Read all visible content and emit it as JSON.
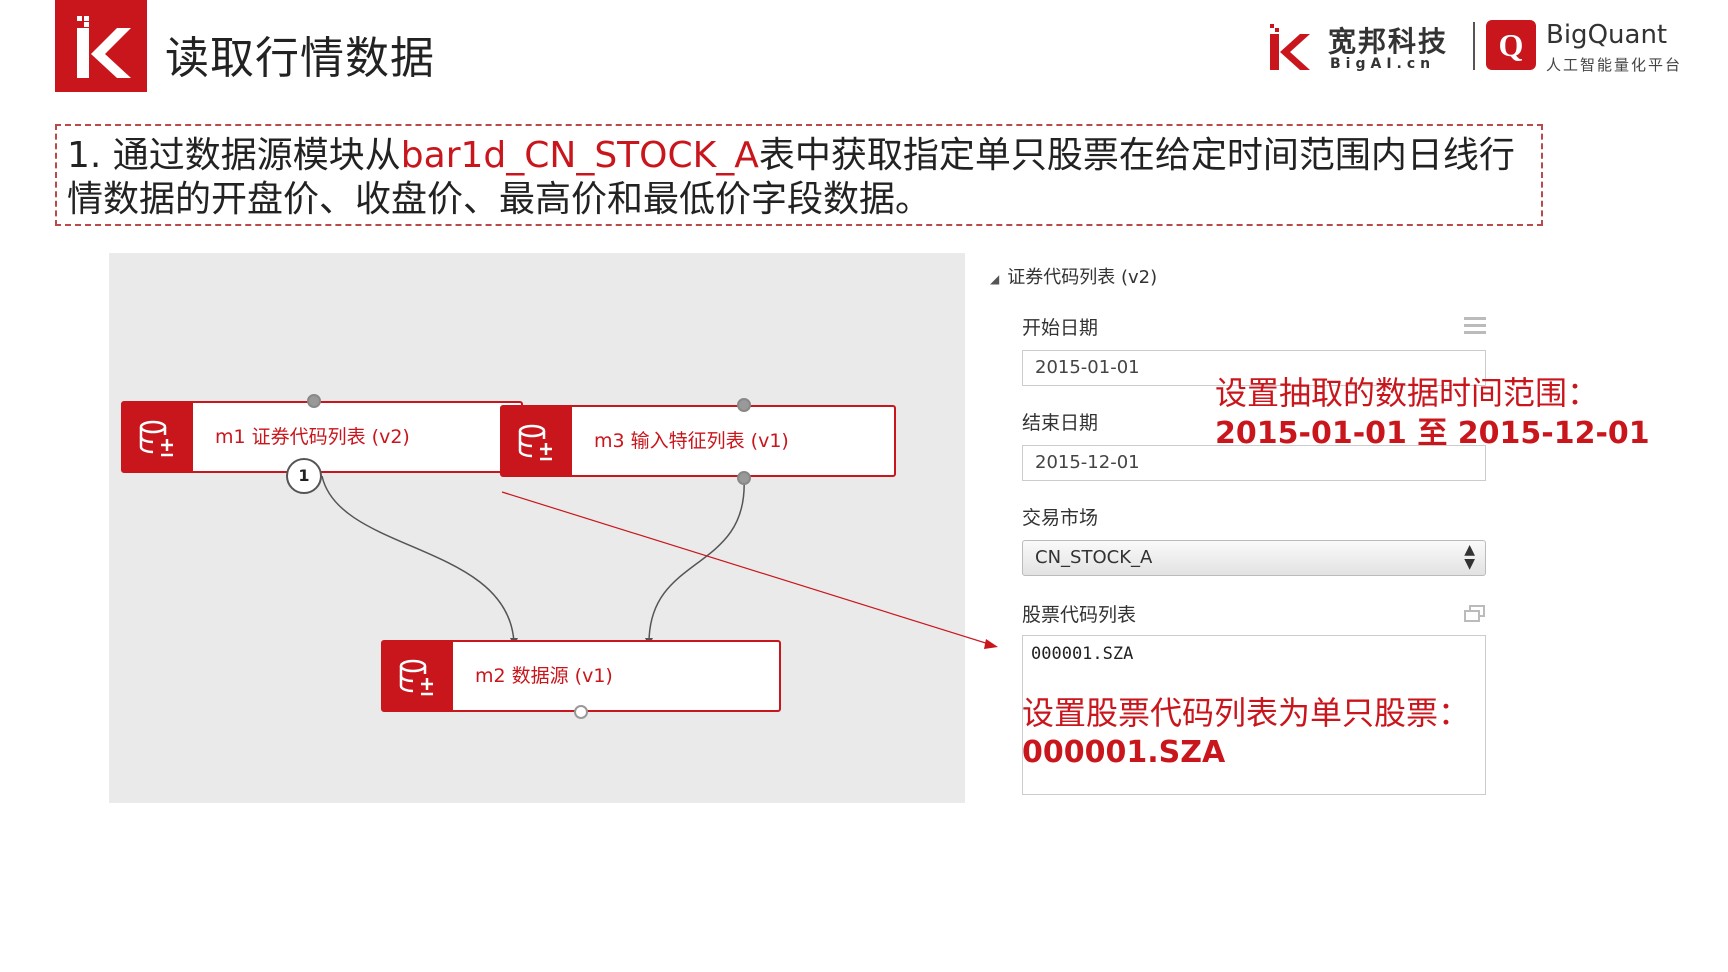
{
  "header": {
    "title": "读取行情数据",
    "brand": {
      "name": "宽邦科技",
      "sub": "BigAI.cn",
      "product": "BigQuant",
      "product_sub": "人工智能量化平台",
      "product_logo": "Q"
    }
  },
  "instruction": {
    "prefix": "1. 通过数据源模块从",
    "table": "bar1d_CN_STOCK_A",
    "suffix": "表中获取指定单只股票在给定时间范围内日线行情数据的开盘价、收盘价、最高价和最低价字段数据。"
  },
  "canvas": {
    "nodes": [
      {
        "id": "m1",
        "label": "m1 证券代码列表 (v2)",
        "icon": "database-add-icon"
      },
      {
        "id": "m3",
        "label": "m3 输入特征列表 (v1)",
        "icon": "database-add-icon"
      },
      {
        "id": "m2",
        "label": "m2 数据源 (v1)",
        "icon": "database-add-icon"
      }
    ],
    "port_badge": "1"
  },
  "panel": {
    "title": "证券代码列表 (v2)",
    "start_date": {
      "label": "开始日期",
      "value": "2015-01-01"
    },
    "end_date": {
      "label": "结束日期",
      "value": "2015-12-01"
    },
    "market": {
      "label": "交易市场",
      "value": "CN_STOCK_A"
    },
    "instruments": {
      "label": "股票代码列表",
      "value": "000001.SZA"
    }
  },
  "annotations": {
    "time_range_title": "设置抽取的数据时间范围：",
    "time_range_value": "2015-01-01 至 2015-12-01",
    "stock_title": "设置股票代码列表为单只股票：",
    "stock_value": "000001.SZA"
  },
  "colors": {
    "accent": "#c9161c"
  }
}
